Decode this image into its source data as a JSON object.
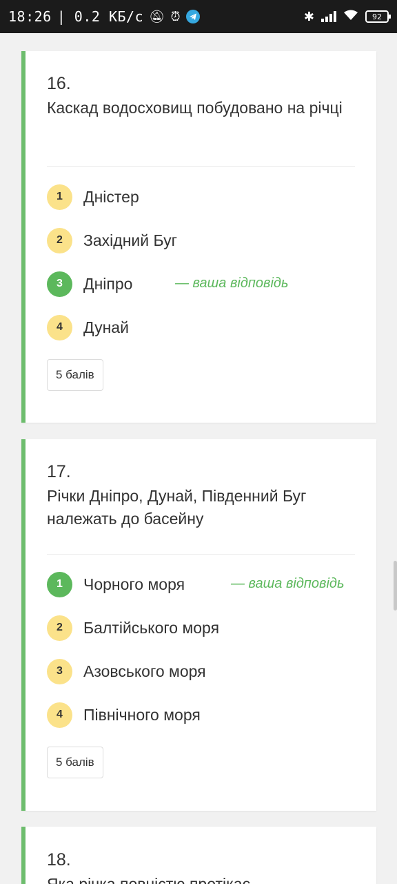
{
  "status_bar": {
    "time": "18:26",
    "speed": "| 0.2 КБ/с",
    "battery": "92"
  },
  "questions": [
    {
      "number": "16.",
      "text": "Каскад водосховищ побудовано на річці",
      "options": [
        {
          "index": "1",
          "label": "Дністер"
        },
        {
          "index": "2",
          "label": "Західний Буг"
        },
        {
          "index": "3",
          "label": "Дніпро"
        },
        {
          "index": "4",
          "label": "Дунай"
        }
      ],
      "your_answer_note": "— ваша відповідь",
      "points": "5 балів"
    },
    {
      "number": "17.",
      "text": "Річки Дніпро, Дунай, Південний Буг належать до басейну",
      "options": [
        {
          "index": "1",
          "label": "Чорного моря"
        },
        {
          "index": "2",
          "label": "Балтійського моря"
        },
        {
          "index": "3",
          "label": "Азовського моря"
        },
        {
          "index": "4",
          "label": "Північного моря"
        }
      ],
      "your_answer_note": "— ваша відповідь",
      "points": "5 балів"
    },
    {
      "number": "18.",
      "text": "Яка річка повністю протікає"
    }
  ],
  "colors": {
    "accent_green": "#5cb85c",
    "card_border": "#6dbd6d",
    "badge_yellow": "#fbe28a"
  }
}
